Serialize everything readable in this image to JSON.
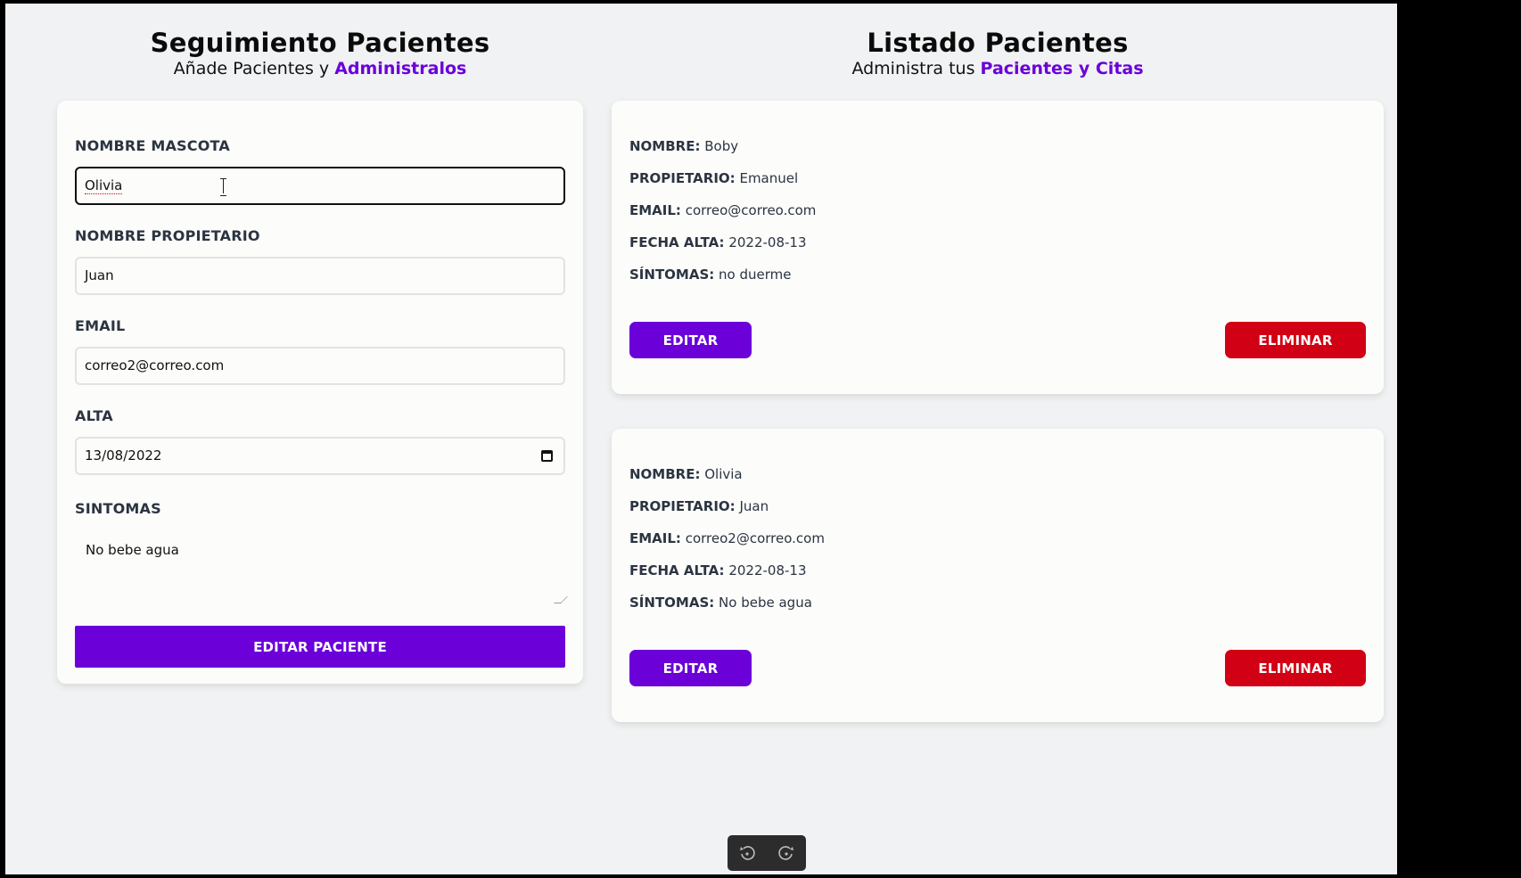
{
  "left_panel": {
    "title": "Seguimiento Pacientes",
    "subtitle_prefix": "Añade Pacientes y ",
    "subtitle_accent": "Administralos"
  },
  "right_panel": {
    "title": "Listado Pacientes",
    "subtitle_prefix": "Administra tus ",
    "subtitle_accent": "Pacientes y Citas"
  },
  "form": {
    "pet_name": {
      "label": "NOMBRE MASCOTA",
      "value": "Olivia"
    },
    "owner_name": {
      "label": "NOMBRE PROPIETARIO",
      "value": "Juan"
    },
    "email": {
      "label": "EMAIL",
      "value": "correo2@correo.com"
    },
    "date": {
      "label": "ALTA",
      "value": "13/08/2022"
    },
    "symptoms": {
      "label": "SINTOMAS",
      "value": "No bebe agua"
    },
    "submit_label": "EDITAR PACIENTE"
  },
  "patients": [
    {
      "name_label": "NOMBRE:",
      "name": "Boby",
      "owner_label": "PROPIETARIO:",
      "owner": "Emanuel",
      "email_label": "EMAIL:",
      "email": "correo@correo.com",
      "date_label": "FECHA ALTA:",
      "date": "2022-08-13",
      "symptoms_label": "SÍNTOMAS:",
      "symptoms": "no duerme",
      "edit_label": "EDITAR",
      "delete_label": "ELIMINAR"
    },
    {
      "name_label": "NOMBRE:",
      "name": "Olivia",
      "owner_label": "PROPIETARIO:",
      "owner": "Juan",
      "email_label": "EMAIL:",
      "email": "correo2@correo.com",
      "date_label": "FECHA ALTA:",
      "date": "2022-08-13",
      "symptoms_label": "SÍNTOMAS:",
      "symptoms": "No bebe agua",
      "edit_label": "EDITAR",
      "delete_label": "ELIMINAR"
    }
  ],
  "toolbar": {
    "left_icon": "rotate-left-icon",
    "right_icon": "rotate-right-icon"
  },
  "colors": {
    "accent": "#6b00d9",
    "danger": "#d10014",
    "background": "#f0f2f3",
    "card": "#fcfcfa"
  }
}
